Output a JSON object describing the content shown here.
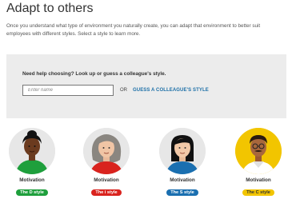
{
  "page": {
    "title": "Adapt to others",
    "intro": "Once you understand what type of environment you naturally create, you can adapt that environment to better suit employees with different styles. Select a style to learn more."
  },
  "help": {
    "heading": "Need help choosing? Look up or guess a colleague's style.",
    "input_placeholder": "Enter name",
    "or_text": "OR",
    "guess_link": "GUESS A COLLEAGUE'S STYLE"
  },
  "styles": [
    {
      "label": "Motivation",
      "badge": "The D style",
      "color": "#1e9f3c"
    },
    {
      "label": "Motivation",
      "badge": "The i style",
      "color": "#d9231e"
    },
    {
      "label": "Motivation",
      "badge": "The S style",
      "color": "#1a6fb0"
    },
    {
      "label": "Motivation",
      "badge": "The C style",
      "color": "#f2c500"
    }
  ]
}
